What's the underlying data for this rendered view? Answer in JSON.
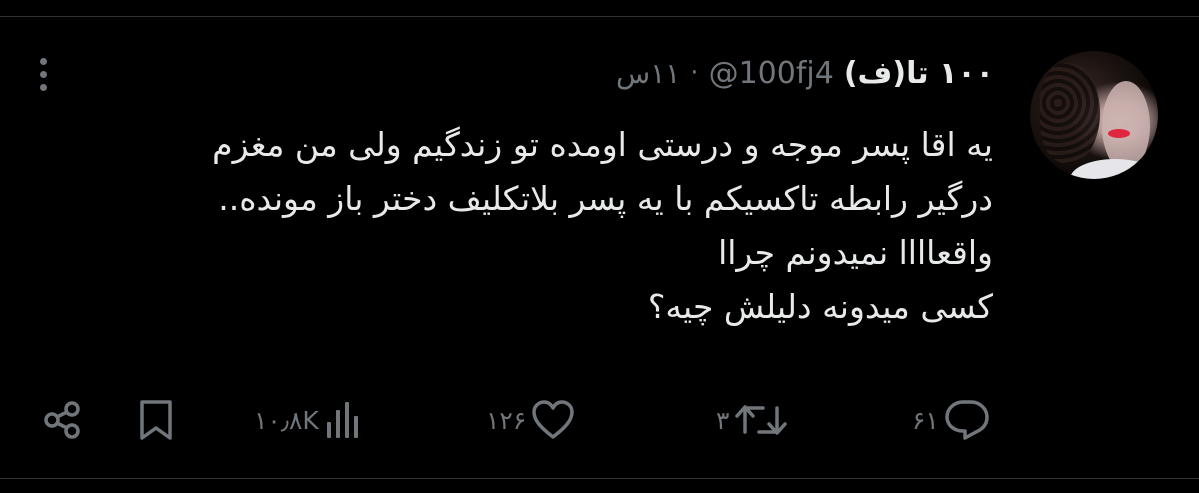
{
  "tweet": {
    "display_name": "۱۰۰ تا(ف)",
    "handle": "@100fj4",
    "separator": "·",
    "time": "۱۱س",
    "body_lines": [
      "یه اقا پسر موجه و درستی اومده تو زندگیم ولی من مغزم",
      "درگیر رابطه تاکسیکم با یه پسر بلاتکلیف دختر باز مونده..",
      "واقعاااا نمیدونم چراا",
      "کسی میدونه دلیلش چیه؟"
    ],
    "actions": {
      "replies": "۶۱",
      "retweets": "۳",
      "likes": "۱۲۶",
      "views": "۱۰٫۸K"
    },
    "icons": {
      "more": "more-vertical-icon",
      "share": "share-icon",
      "bookmark": "bookmark-icon",
      "views": "views-chart-icon",
      "like": "heart-icon",
      "retweet": "retweet-icon",
      "reply": "reply-icon"
    },
    "colors": {
      "background": "#000000",
      "text": "#e7e9ea",
      "muted": "#71767b",
      "border": "#2f3336"
    }
  }
}
